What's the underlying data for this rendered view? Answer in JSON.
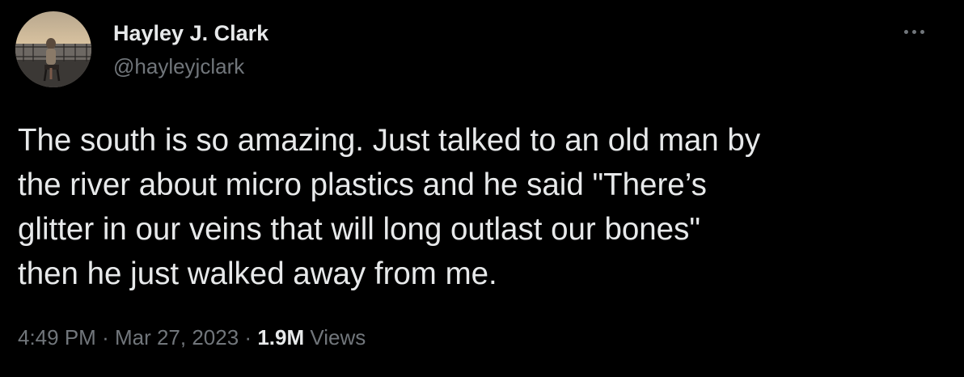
{
  "user": {
    "display_name": "Hayley J. Clark",
    "handle": "@hayleyjclark"
  },
  "tweet": {
    "text_lines": [
      "The south is so amazing. Just talked to an old man by",
      "the river about micro plastics and he said \"There’s",
      "glitter in our veins that will long outlast our bones\"",
      "then he just walked away from me."
    ],
    "time": "4:49 PM",
    "separator": "·",
    "date": "Mar 27, 2023",
    "views_count": "1.9M",
    "views_label": "Views"
  },
  "icons": {
    "more": "more-horizontal-icon"
  },
  "colors": {
    "background": "#000000",
    "primary_text": "#e7e9ea",
    "secondary_text": "#71767b"
  }
}
